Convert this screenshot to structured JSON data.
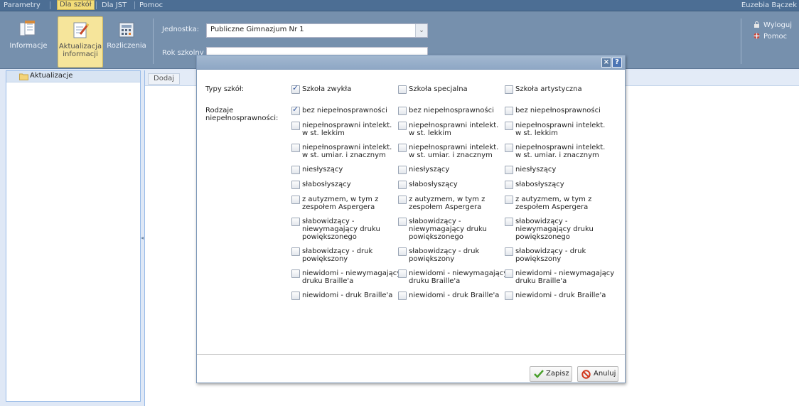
{
  "menu": {
    "items": [
      "Parametry",
      "Dla szkół",
      "Dla JST",
      "Pomoc"
    ],
    "active_index": 1
  },
  "user": {
    "name": "Euzebia Bączek"
  },
  "toolbar": {
    "buttons": [
      {
        "label": "Informacje",
        "icon": "documents-icon"
      },
      {
        "label": "Aktualizacja\ninformacji",
        "label_line1": "Aktualizacja",
        "label_line2": "informacji",
        "icon": "edit-document-icon"
      },
      {
        "label": "Rozliczenia",
        "icon": "calculator-icon"
      }
    ],
    "jednostka_label": "Jednostka:",
    "jednostka_value": "Publiczne Gimnazjum Nr 1",
    "rok_label": "Rok szkolny",
    "links": {
      "logout": "Wyloguj",
      "help": "Pomoc"
    }
  },
  "left_panel": {
    "root_node": "Aktualizacje"
  },
  "main_panel": {
    "add_button": "Dodaj"
  },
  "dialog": {
    "tool_close": "×",
    "tool_help": "?",
    "school_types_label": "Typy szkół:",
    "disability_label_line1": "Rodzaje",
    "disability_label_line2": "niepełnosprawności:",
    "school_types": [
      {
        "label": "Szkoła zwykła",
        "checked": true
      },
      {
        "label": "Szkoła specjalna",
        "checked": false
      },
      {
        "label": "Szkoła artystyczna",
        "checked": false
      }
    ],
    "disabilities": [
      [
        "bez niepełnosprawności"
      ],
      [
        "niepełnosprawni intelekt.",
        "w st. lekkim"
      ],
      [
        "niepełnosprawni intelekt.",
        "w st. umiar. i znacznym"
      ],
      [
        "niesłyszący"
      ],
      [
        "słabosłyszący"
      ],
      [
        "z autyzmem, w tym z",
        "zespołem Aspergera"
      ],
      [
        "słabowidzący -",
        "niewymagający druku",
        "powiększonego"
      ],
      [
        "słabowidzący - druk",
        "powiększony"
      ],
      [
        "niewidomi - niewymagający",
        "druku Braille'a"
      ],
      [
        "niewidomi - druk Braille'a"
      ]
    ],
    "disabilities_checked_first_column_first": true,
    "save_label": "Zapisz",
    "cancel_label": "Anuluj"
  },
  "colors": {
    "menubar": "#4c6e94",
    "toolbar": "#7690ad",
    "selected_highlight": "#f6e59b",
    "panel_border": "#99bbe8"
  }
}
